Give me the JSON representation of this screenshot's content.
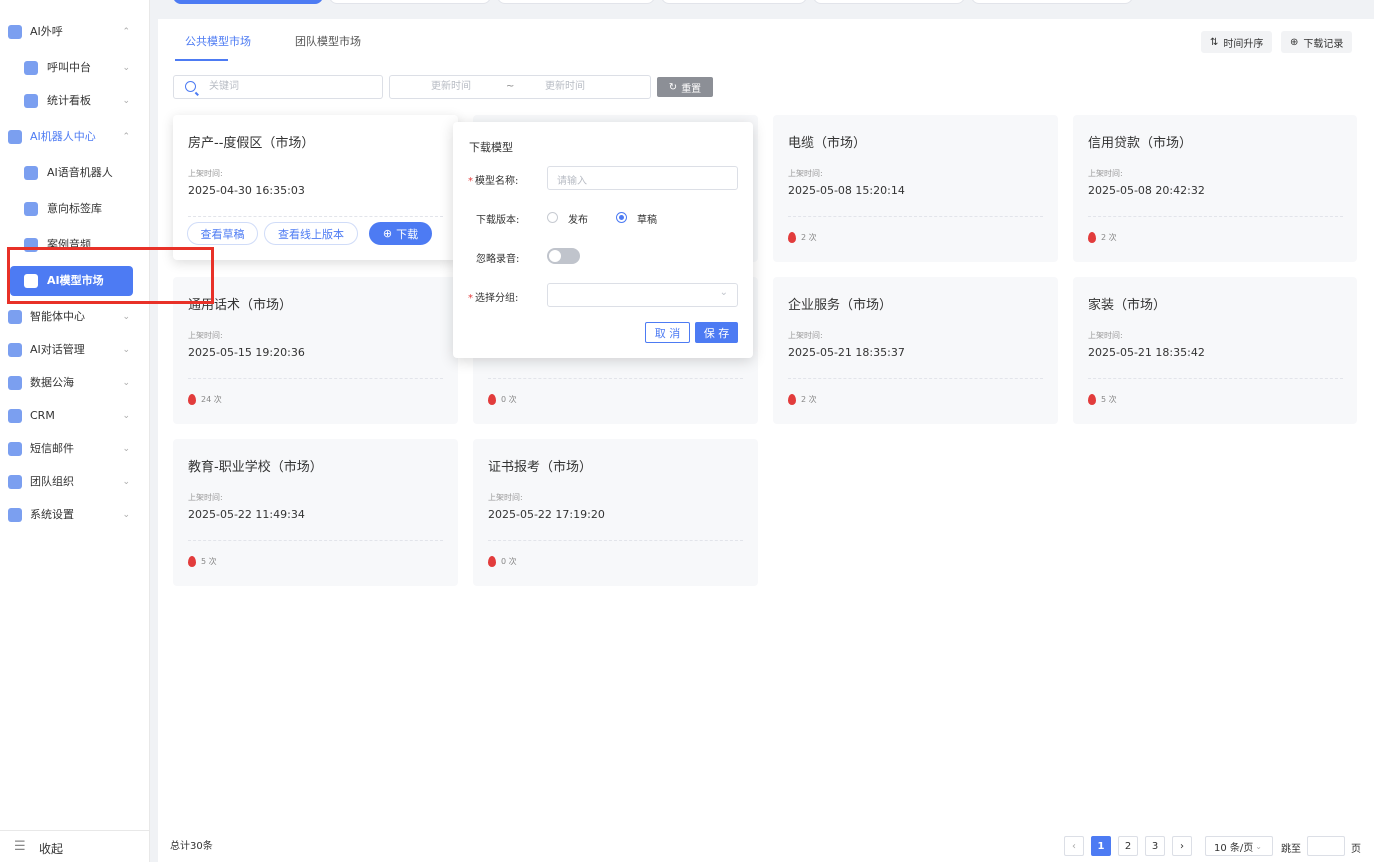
{
  "sidebar": {
    "items": [
      {
        "label": "AI外呼"
      },
      {
        "label": "呼叫中台"
      },
      {
        "label": "统计看板"
      },
      {
        "label": "AI机器人中心"
      },
      {
        "label": "AI语音机器人"
      },
      {
        "label": "意向标签库"
      },
      {
        "label": "案例音频"
      },
      {
        "label": "AI模型市场"
      },
      {
        "label": "智能体中心"
      },
      {
        "label": "AI对话管理"
      },
      {
        "label": "数据公海"
      },
      {
        "label": "CRM"
      },
      {
        "label": "短信邮件"
      },
      {
        "label": "团队组织"
      },
      {
        "label": "系统设置"
      }
    ],
    "collapse_label": "收起"
  },
  "tabs": [
    {
      "label": "公共模型市场"
    },
    {
      "label": "团队模型市场"
    }
  ],
  "toolbar": {
    "sort_label": "时间升序",
    "download_log_label": "下载记录"
  },
  "filters": {
    "search_placeholder": "关键词",
    "start_placeholder": "更新时间",
    "separator": "~",
    "end_placeholder": "更新时间",
    "reset_label": "重置"
  },
  "card_common": {
    "time_label": "上架时间:",
    "count_unit": "次"
  },
  "cards": [
    {
      "title": "房产--度假区（市场）",
      "time": "2025-04-30 16:35:03",
      "count": ""
    },
    {
      "title": "",
      "time": "",
      "count": ""
    },
    {
      "title": "电缆（市场）",
      "time": "2025-05-08 15:20:14",
      "count": "2"
    },
    {
      "title": "信用贷款（市场）",
      "time": "2025-05-08 20:42:32",
      "count": "2"
    },
    {
      "title": "通用话术（市场）",
      "time": "2025-05-15 19:20:36",
      "count": "24"
    },
    {
      "title": "",
      "time": "",
      "count": "0"
    },
    {
      "title": "企业服务（市场）",
      "time": "2025-05-21 18:35:37",
      "count": "2"
    },
    {
      "title": "家装（市场）",
      "time": "2025-05-21 18:35:42",
      "count": "5"
    },
    {
      "title": "教育-职业学校（市场）",
      "time": "2025-05-22 11:49:34",
      "count": "5"
    },
    {
      "title": "证书报考（市场）",
      "time": "2025-05-22 17:19:20",
      "count": "0"
    }
  ],
  "card_actions": {
    "view_draft": "查看草稿",
    "view_online": "查看线上版本",
    "download": "下载"
  },
  "download_popover": {
    "title": "下载模型",
    "name_label": "模型名称:",
    "name_placeholder": "请输入",
    "version_label": "下载版本:",
    "version_options": [
      "发布",
      "草稿"
    ],
    "version_selected": "草稿",
    "ignore_audio_label": "忽略录音:",
    "ignore_audio_on": false,
    "group_label": "选择分组:",
    "cancel_label": "取 消",
    "save_label": "保 存"
  },
  "pagination": {
    "total_text": "总计30条",
    "pages": [
      "1",
      "2",
      "3"
    ],
    "current": "1",
    "page_size": "10 条/页",
    "jump_label": "跳至",
    "page_suffix": "页"
  },
  "colors": {
    "accent": "#4d7bf3",
    "highlight": "#e83128",
    "fire": "#e23c3c"
  }
}
